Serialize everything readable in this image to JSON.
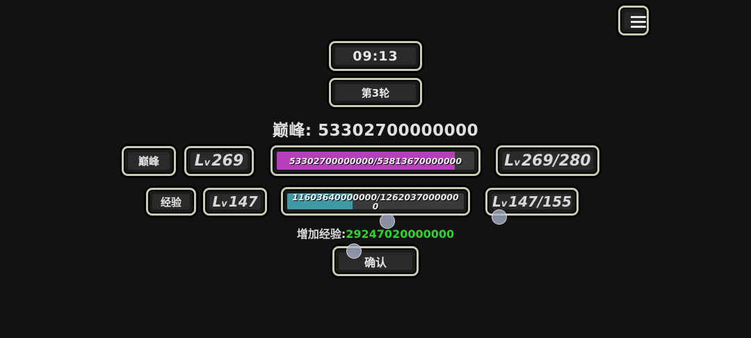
{
  "menu": {
    "icon": "hamburger-menu-icon"
  },
  "timer": {
    "text": "09:13"
  },
  "round": {
    "label": "第3轮"
  },
  "peak_total": {
    "label": "巅峰",
    "separator": ":",
    "value": "53302700000000"
  },
  "peak_row": {
    "name": "巅峰",
    "lv_prefix": "L",
    "lv_small": "v",
    "level": "269",
    "progress_text": "53302700000000/53813670000000",
    "progress_fraction": 0.9,
    "level_range": "269/280",
    "bar_color": "#b43fb8"
  },
  "exp_row": {
    "name": "经验",
    "lv_prefix": "L",
    "lv_small": "v",
    "level": "147",
    "progress_text": "11603640000000/12620370000000",
    "progress_fraction": 0.37,
    "level_range": "147/155",
    "bar_color": "#3d9aa5"
  },
  "gain": {
    "label": "增加经验:",
    "value": "29247020000000",
    "value_color": "#2fd22f"
  },
  "confirm": {
    "label": "确认"
  }
}
